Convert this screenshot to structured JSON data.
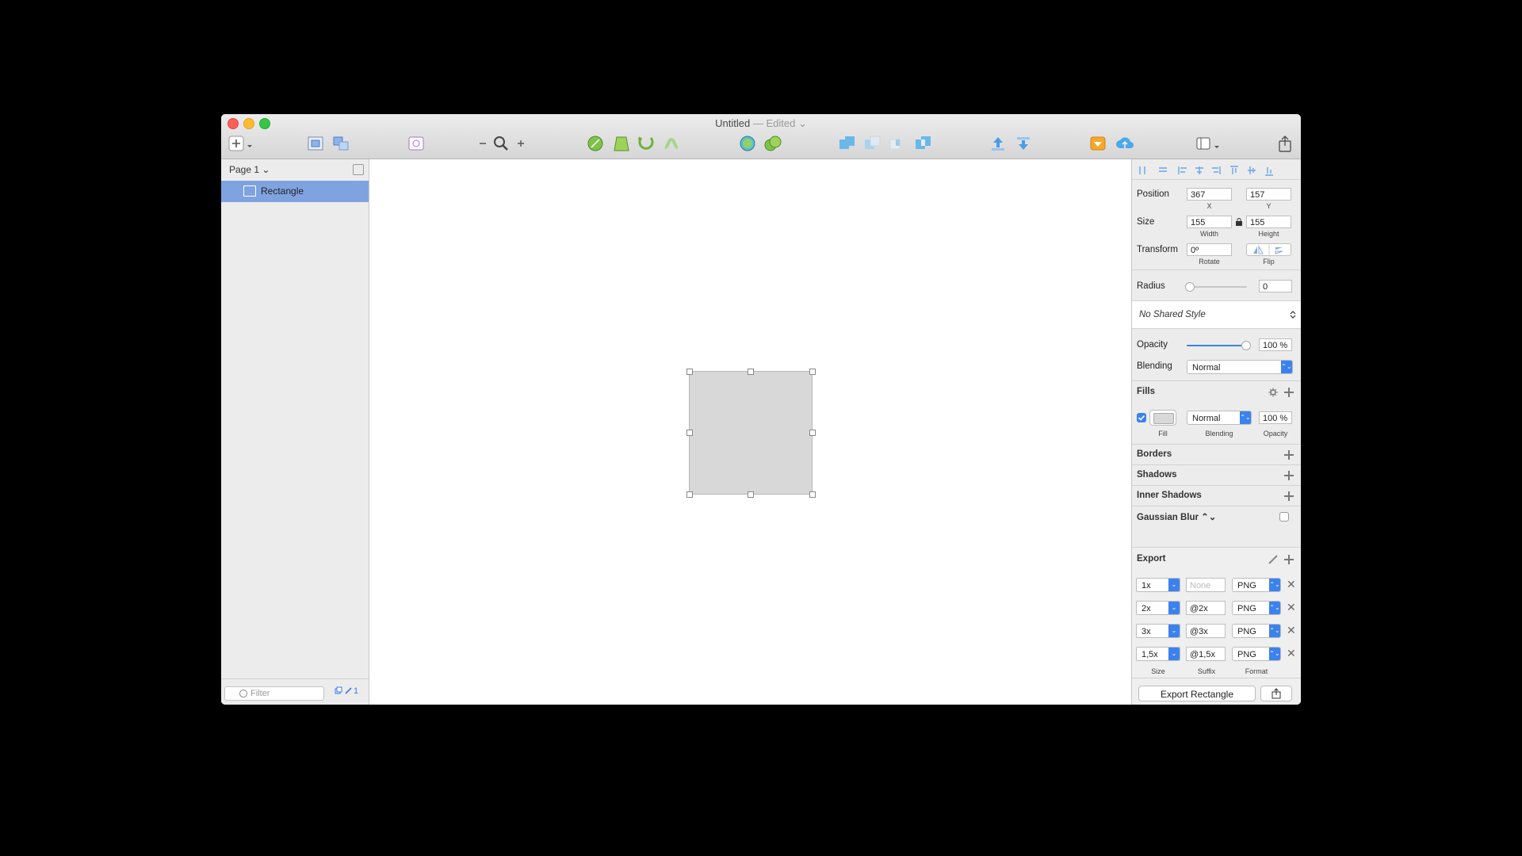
{
  "window": {
    "title": "Untitled",
    "edited": "— Edited ⌄"
  },
  "layers": {
    "page_label": "Page 1 ⌄",
    "items": [
      {
        "label": "Rectangle"
      }
    ],
    "filter_placeholder": "Filter",
    "footer_count": "1"
  },
  "inspector": {
    "position": {
      "label": "Position",
      "x": "367",
      "y": "157",
      "x_label": "X",
      "y_label": "Y"
    },
    "size": {
      "label": "Size",
      "width": "155",
      "height": "155",
      "width_label": "Width",
      "height_label": "Height"
    },
    "transform": {
      "label": "Transform",
      "rotate": "0º",
      "rotate_label": "Rotate",
      "flip_label": "Flip"
    },
    "radius": {
      "label": "Radius",
      "value": "0"
    },
    "shared_style": "No Shared Style",
    "opacity": {
      "label": "Opacity",
      "value": "100 %",
      "level": 1.0
    },
    "blending": {
      "label": "Blending",
      "value": "Normal"
    },
    "fills": {
      "title": "Fills",
      "blend": "Normal",
      "opacity": "100 %",
      "fill_label": "Fill",
      "blending_label": "Blending",
      "opacity_label": "Opacity",
      "swatch_color": "#d8d8d8"
    },
    "borders": "Borders",
    "shadows": "Shadows",
    "inner_shadows": "Inner Shadows",
    "gaussian_blur": "Gaussian Blur ⌃⌄",
    "export": {
      "title": "Export",
      "rows": [
        {
          "size": "1x",
          "suffix": "None",
          "format": "PNG"
        },
        {
          "size": "2x",
          "suffix": "@2x",
          "format": "PNG"
        },
        {
          "size": "3x",
          "suffix": "@3x",
          "format": "PNG"
        },
        {
          "size": "1,5x",
          "suffix": "@1,5x",
          "format": "PNG"
        }
      ],
      "size_label": "Size",
      "suffix_label": "Suffix",
      "format_label": "Format",
      "button": "Export Rectangle"
    }
  },
  "colors": {
    "accent": "#3b82ee",
    "selection": "#7fa3e0"
  }
}
